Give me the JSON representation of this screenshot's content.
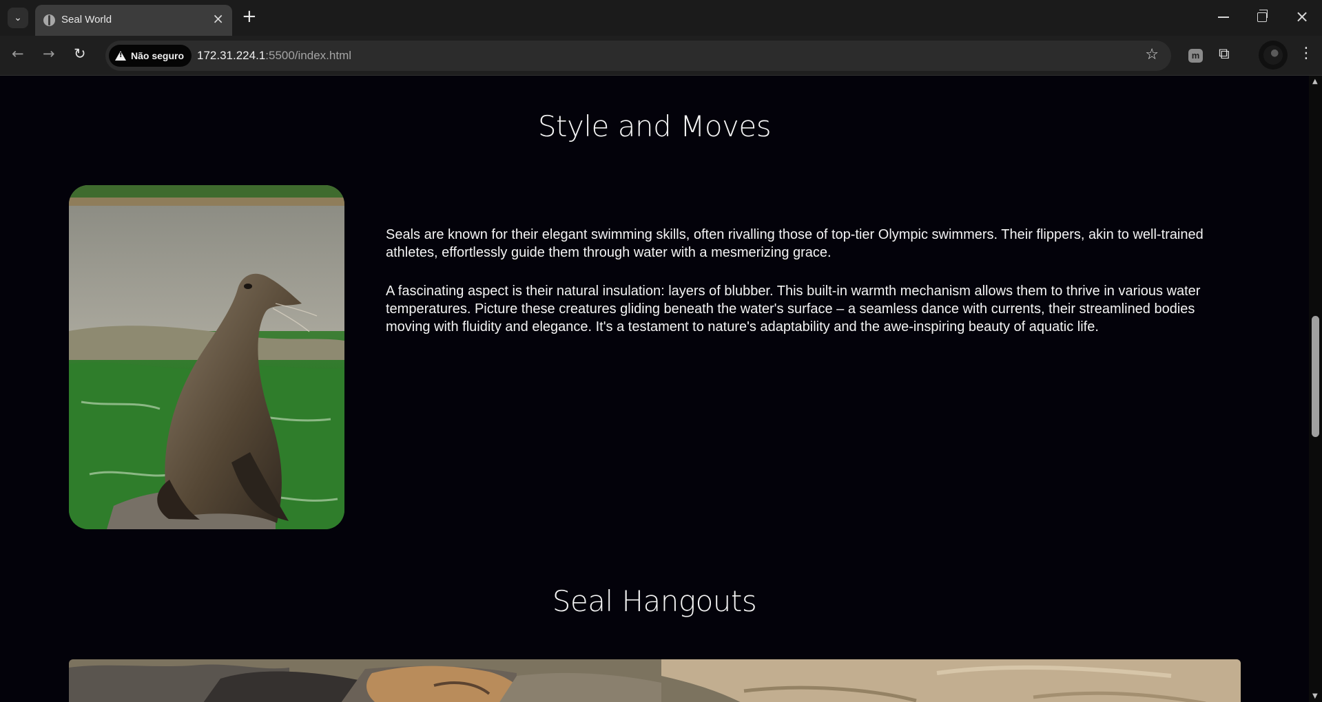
{
  "browser": {
    "tab_title": "Seal World",
    "new_tab_symbol": "+",
    "close_symbol": "×",
    "security_label": "Não seguro",
    "url_host": "172.31.224.1",
    "url_path": ":5500/index.html",
    "extension_m_label": "m",
    "icons": [
      "tab-search-icon",
      "globe-icon",
      "back-icon",
      "forward-icon",
      "reload-icon",
      "warning-icon",
      "star-icon",
      "extension-icon",
      "puzzle-icon",
      "menu-icon",
      "minimize-icon",
      "restore-icon",
      "close-icon"
    ]
  },
  "page": {
    "style_section": {
      "title": "Style and Moves",
      "paragraphs": [
        "Seals are known for their elegant swimming skills, often rivalling those of top-tier Olympic swimmers. Their flippers, akin to well-trained athletes, effortlessly guide them through water with a mesmerizing grace.",
        "A fascinating aspect is their natural insulation: layers of blubber. This built-in warmth mechanism allows them to thrive in various water temperatures. Picture these creatures gliding beneath the water's surface – a seamless dance with currents, their streamlined bodies moving with fluidity and elegance. It's a testament to nature's adaptability and the awe-inspiring beauty of aquatic life."
      ]
    },
    "hangouts_section": {
      "title": "Seal Hangouts"
    }
  },
  "colors": {
    "page_background": "#03020a",
    "text": "#f4f4f4",
    "browser_frame": "#1f1f1f",
    "active_tab": "#3c3c3c"
  }
}
